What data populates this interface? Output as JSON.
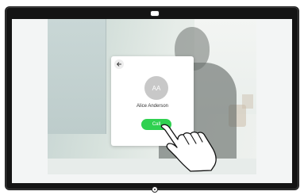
{
  "contact": {
    "initials": "AA",
    "name": "Alice Anderson"
  },
  "actions": {
    "call_label": "Call"
  },
  "icons": {
    "back": "back-arrow-icon",
    "camera": "camera-icon",
    "home": "home-button-icon",
    "gesture": "tap-gesture-hand-icon"
  },
  "colors": {
    "call_accent": "#2fd150",
    "bezel": "#141414",
    "card_bg": "#ffffff",
    "avatar_bg": "#c8c8c8"
  }
}
